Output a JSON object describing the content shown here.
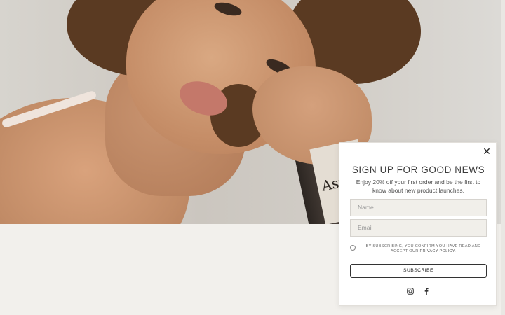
{
  "popup": {
    "close_icon": "close-icon",
    "title": "SIGN UP FOR GOOD NEWS",
    "subtitle": "Enjoy 20% off your first order and be the first to know about new product launches.",
    "name_placeholder": "Name",
    "email_placeholder": "Email",
    "consent_text": "BY SUBSCRIBING, YOU CONFIRM YOU HAVE READ AND ACCEPT OUR",
    "privacy_link": "PRIVACY POLICY.",
    "subscribe_label": "SUBSCRIBE",
    "social_icons": [
      "instagram-icon",
      "facebook-icon"
    ]
  },
  "hero": {
    "bottle_label": "Ast"
  },
  "colors": {
    "page_bg": "#f2f0ec",
    "popup_bg": "#ffffff",
    "field_bg": "#f1efea",
    "text_dark": "#3b3b3b"
  }
}
